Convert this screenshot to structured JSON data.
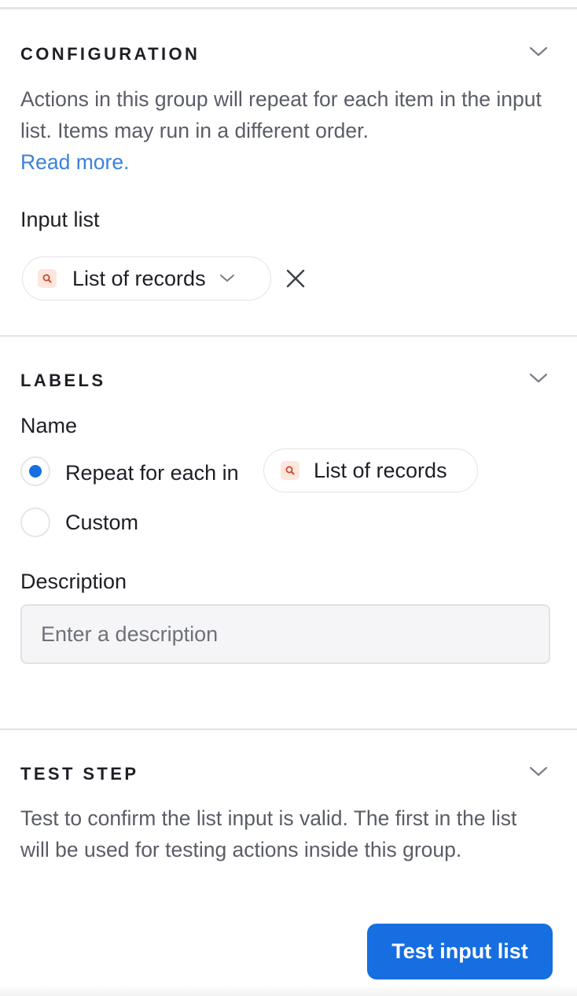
{
  "configuration": {
    "title": "CONFIGURATION",
    "description": "Actions in this group will repeat for each item in the input list. Items may run in a different order.",
    "read_more": "Read more.",
    "input_list_label": "Input list",
    "input_list_value": "List of records",
    "input_list_icon": "search-icon",
    "clear_icon": "close-icon"
  },
  "labels": {
    "title": "LABELS",
    "name_label": "Name",
    "option_repeat": "Repeat for each in",
    "option_repeat_token": "List of records",
    "option_custom": "Custom",
    "selected_option": "Repeat for each in",
    "description_label": "Description",
    "description_placeholder": "Enter a description",
    "description_value": ""
  },
  "test_step": {
    "title": "TEST STEP",
    "description": "Test to confirm the list input is valid. The first in the list will be used for testing actions inside this group.",
    "button_label": "Test input list"
  },
  "colors": {
    "accent": "#166ee1",
    "link": "#3b82d9",
    "token_icon_bg": "#fde6dd",
    "token_icon_fg": "#c9482b"
  }
}
